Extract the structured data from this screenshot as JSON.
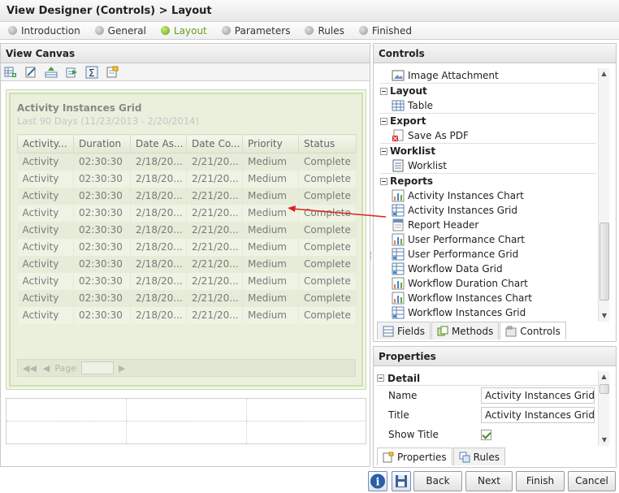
{
  "window": {
    "title": "View Designer (Controls) > Layout"
  },
  "steps": [
    {
      "label": "Introduction",
      "active": false
    },
    {
      "label": "General",
      "active": false
    },
    {
      "label": "Layout",
      "active": true
    },
    {
      "label": "Parameters",
      "active": false
    },
    {
      "label": "Rules",
      "active": false
    },
    {
      "label": "Finished",
      "active": false
    }
  ],
  "canvas": {
    "title": "View Canvas",
    "toolbar_icons": [
      "add-row-icon",
      "edit-icon",
      "insert-icon",
      "export-icon",
      "sum-icon",
      "properties-icon"
    ],
    "grid": {
      "title": "Activity Instances Grid",
      "subtitle": "Last 90 Days (11/23/2013 - 2/20/2014)",
      "columns": [
        "Activity...",
        "Duration",
        "Date As...",
        "Date Co...",
        "Priority",
        "Status"
      ],
      "rows": [
        [
          "Activity",
          "02:30:30",
          "2/18/20...",
          "2/21/20...",
          "Medium",
          "Complete"
        ],
        [
          "Activity",
          "02:30:30",
          "2/18/20...",
          "2/21/20...",
          "Medium",
          "Complete"
        ],
        [
          "Activity",
          "02:30:30",
          "2/18/20...",
          "2/21/20...",
          "Medium",
          "Complete"
        ],
        [
          "Activity",
          "02:30:30",
          "2/18/20...",
          "2/21/20...",
          "Medium",
          "Complete"
        ],
        [
          "Activity",
          "02:30:30",
          "2/18/20...",
          "2/21/20...",
          "Medium",
          "Complete"
        ],
        [
          "Activity",
          "02:30:30",
          "2/18/20...",
          "2/21/20...",
          "Medium",
          "Complete"
        ],
        [
          "Activity",
          "02:30:30",
          "2/18/20...",
          "2/21/20...",
          "Medium",
          "Complete"
        ],
        [
          "Activity",
          "02:30:30",
          "2/18/20...",
          "2/21/20...",
          "Medium",
          "Complete"
        ],
        [
          "Activity",
          "02:30:30",
          "2/18/20...",
          "2/21/20...",
          "Medium",
          "Complete"
        ],
        [
          "Activity",
          "02:30:30",
          "2/18/20...",
          "2/21/20...",
          "Medium",
          "Complete"
        ]
      ],
      "pager_label": "Page"
    }
  },
  "controls": {
    "title": "Controls",
    "items": [
      {
        "type": "item",
        "label": "Image Attachment",
        "icon": "image-icon"
      },
      {
        "type": "category",
        "label": "Layout"
      },
      {
        "type": "item",
        "label": "Table",
        "icon": "table-icon"
      },
      {
        "type": "category",
        "label": "Export"
      },
      {
        "type": "item",
        "label": "Save As PDF",
        "icon": "pdf-icon"
      },
      {
        "type": "category",
        "label": "Worklist"
      },
      {
        "type": "item",
        "label": "Worklist",
        "icon": "worklist-icon"
      },
      {
        "type": "category",
        "label": "Reports"
      },
      {
        "type": "item",
        "label": "Activity Instances Chart",
        "icon": "chart-icon"
      },
      {
        "type": "item",
        "label": "Activity Instances Grid",
        "icon": "grid-icon"
      },
      {
        "type": "item",
        "label": "Report Header",
        "icon": "report-header-icon"
      },
      {
        "type": "item",
        "label": "User Performance Chart",
        "icon": "chart-icon"
      },
      {
        "type": "item",
        "label": "User Performance Grid",
        "icon": "grid-icon"
      },
      {
        "type": "item",
        "label": "Workflow Data Grid",
        "icon": "grid-icon"
      },
      {
        "type": "item",
        "label": "Workflow Duration Chart",
        "icon": "chart-icon"
      },
      {
        "type": "item",
        "label": "Workflow Instances Chart",
        "icon": "chart-icon"
      },
      {
        "type": "item",
        "label": "Workflow Instances Grid",
        "icon": "grid-icon"
      }
    ],
    "tabs": [
      {
        "label": "Fields",
        "active": false
      },
      {
        "label": "Methods",
        "active": false
      },
      {
        "label": "Controls",
        "active": true
      }
    ]
  },
  "properties": {
    "title": "Properties",
    "section": "Detail",
    "fields": [
      {
        "label": "Name",
        "value": "Activity Instances Grid"
      },
      {
        "label": "Title",
        "value": "Activity Instances Grid"
      },
      {
        "label": "Show Title",
        "checked": true
      }
    ],
    "tabs": [
      {
        "label": "Properties",
        "active": true
      },
      {
        "label": "Rules",
        "active": false
      }
    ]
  },
  "footer": {
    "back": "Back",
    "next": "Next",
    "finish": "Finish",
    "cancel": "Cancel"
  },
  "colors": {
    "accent": "#6aa017",
    "arrow": "#e02020"
  }
}
